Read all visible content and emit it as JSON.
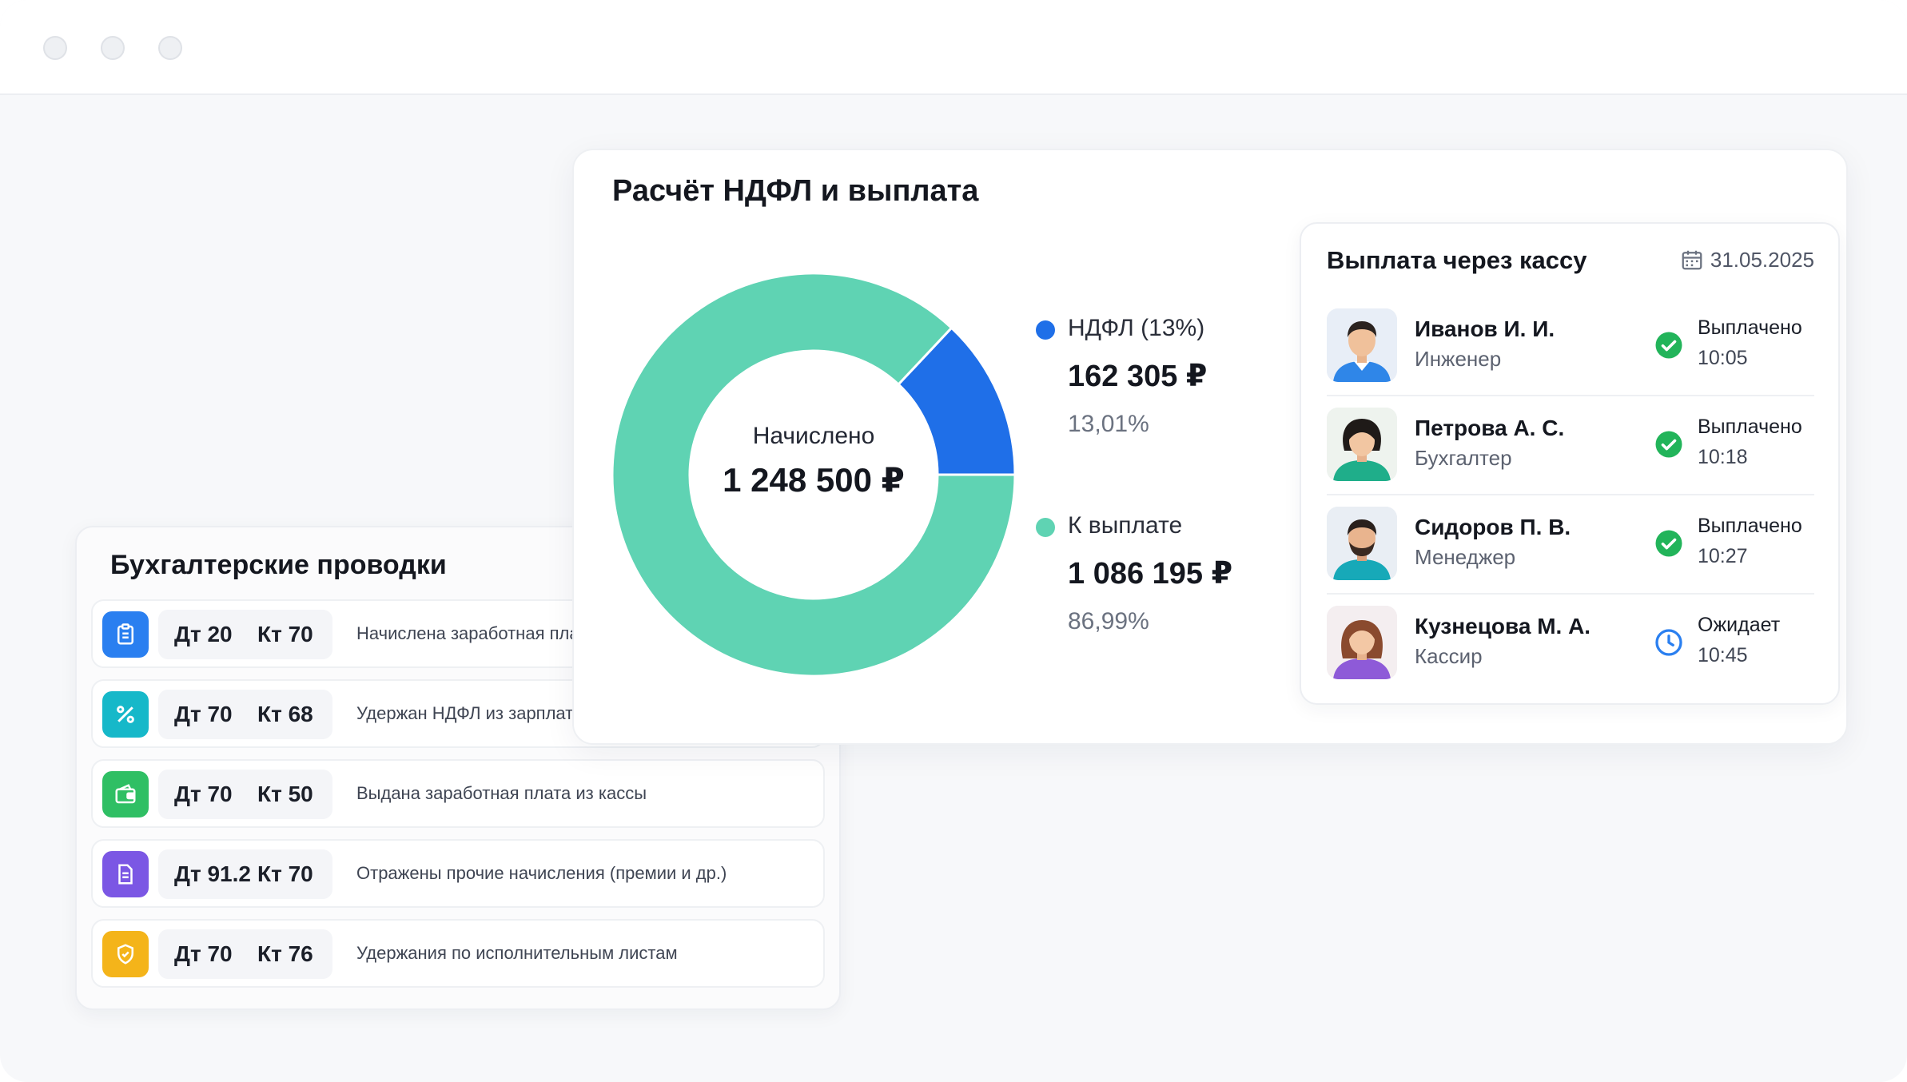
{
  "colors": {
    "ndfl": "#1f6fe8",
    "payout": "#5fd3b3",
    "paid_status": "#22b45a",
    "waiting_status": "#2a7ff0"
  },
  "main": {
    "title": "Расчёт НДФЛ и выплата",
    "donut_center_label": "Начислено",
    "donut_center_value": "1 248 500 ₽",
    "legend": [
      {
        "name": "НДФЛ (13%)",
        "amount": "162 305 ₽",
        "percent": "13,01%"
      },
      {
        "name": "К выплате",
        "amount": "1 086 195 ₽",
        "percent": "86,99%"
      }
    ]
  },
  "chart_data": {
    "type": "pie",
    "donut": true,
    "categories": [
      "НДФЛ (13%)",
      "К выплате"
    ],
    "values": [
      162305,
      1086195
    ],
    "percent": [
      13.01,
      86.99
    ],
    "title": "Расчёт НДФЛ и выплата",
    "center_label": "Начислено",
    "center_value": "1 248 500 ₽"
  },
  "payout": {
    "title": "Выплата через кассу",
    "date": "31.05.2025",
    "date_icon": "calendar-icon",
    "people": [
      {
        "name": "Иванов И. И.",
        "role": "Инженер",
        "status": "Выплачено",
        "time": "10:05",
        "status_icon": "check-circle-icon",
        "avatar": "male-engineer"
      },
      {
        "name": "Петрова А. С.",
        "role": "Бухгалтер",
        "status": "Выплачено",
        "time": "10:18",
        "status_icon": "check-circle-icon",
        "avatar": "female-accountant"
      },
      {
        "name": "Сидоров П. В.",
        "role": "Менеджер",
        "status": "Выплачено",
        "time": "10:27",
        "status_icon": "check-circle-icon",
        "avatar": "male-manager"
      },
      {
        "name": "Кузнецова М. А.",
        "role": "Кассир",
        "status": "Ожидает",
        "time": "10:45",
        "status_icon": "clock-icon",
        "avatar": "female-cashier"
      }
    ]
  },
  "entries": {
    "title": "Бухгалтерские проводки",
    "rows": [
      {
        "debit": "Дт 20",
        "credit": "Кт 70",
        "description": "Начислена заработная плата",
        "icon": "clipboard-icon",
        "color": "#2a7ff0"
      },
      {
        "debit": "Дт 70",
        "credit": "Кт 68",
        "description": "Удержан НДФЛ из зарплаты",
        "icon": "percent-icon",
        "color": "#16b8c9"
      },
      {
        "debit": "Дт 70",
        "credit": "Кт 50",
        "description": "Выдана заработная плата из кассы",
        "icon": "wallet-icon",
        "color": "#2fbf64"
      },
      {
        "debit": "Дт 91.2",
        "credit": "Кт 70",
        "description": "Отражены прочие начисления (премии и др.)",
        "icon": "document-icon",
        "color": "#7b57e4"
      },
      {
        "debit": "Дт 70",
        "credit": "Кт 76",
        "description": "Удержания по исполнительным листам",
        "icon": "shield-icon",
        "color": "#f4b41a"
      }
    ]
  }
}
